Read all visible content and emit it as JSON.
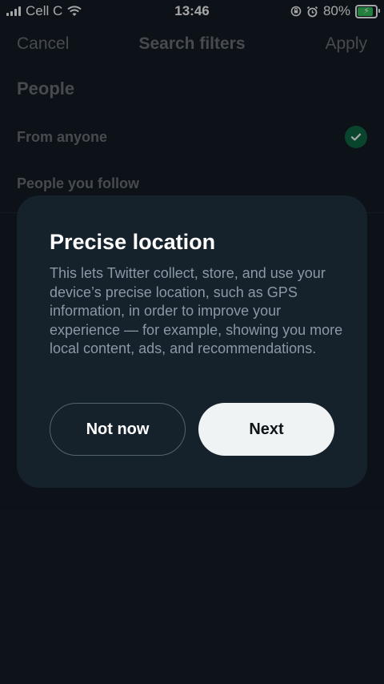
{
  "status_bar": {
    "carrier": "Cell C",
    "time": "13:46",
    "battery_percent": "80%",
    "battery_level": 0.8
  },
  "nav": {
    "cancel": "Cancel",
    "title": "Search filters",
    "apply": "Apply"
  },
  "people": {
    "section_title": "People",
    "options": [
      {
        "label": "From anyone",
        "selected": true
      },
      {
        "label": "People you follow",
        "selected": false
      }
    ]
  },
  "dialog": {
    "title": "Precise location",
    "body": "This lets Twitter collect, store, and use your device’s precise location, such as GPS information, in order to improve your experience — for example, showing you more local content, ads, and recommendations.",
    "secondary_button": "Not now",
    "primary_button": "Next"
  },
  "colors": {
    "background": "#141d26",
    "dialog": "#15212b",
    "check_green": "#0f6b46",
    "primary_button": "#eff3f4"
  },
  "icons": [
    "signal-bars-icon",
    "wifi-icon",
    "rotation-lock-icon",
    "alarm-icon",
    "battery-charging-icon",
    "checkmark-icon"
  ]
}
